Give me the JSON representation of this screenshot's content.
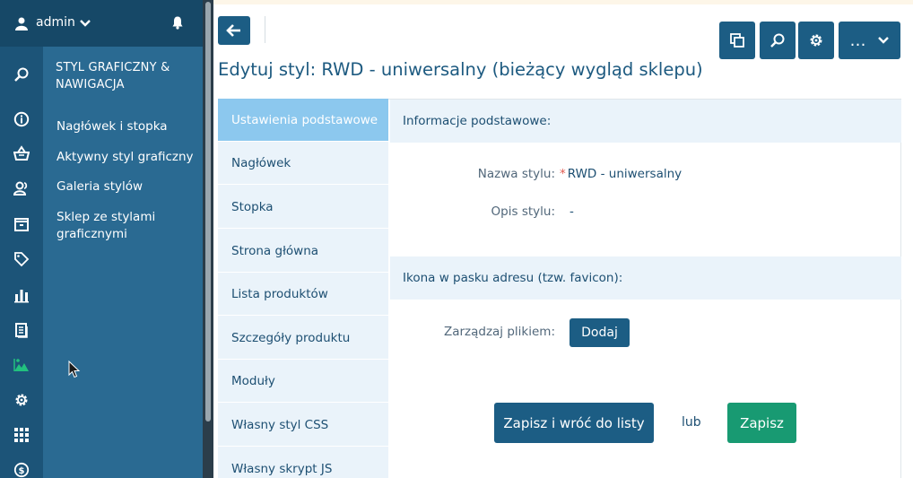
{
  "user": {
    "name": "admin"
  },
  "subnav": {
    "title": "STYL GRAFICZNY & NAWIGACJA",
    "items": [
      {
        "label": "Nagłówek i stopka"
      },
      {
        "label": "Aktywny styl graficzny"
      },
      {
        "label": "Galeria stylów"
      },
      {
        "label": "Sklep ze stylami graficznymi"
      }
    ]
  },
  "rail": {
    "icons": [
      "search-icon",
      "info-icon",
      "basket-icon",
      "users-icon",
      "box-icon",
      "tag-icon",
      "chart-icon",
      "documents-icon",
      "landscape-icon",
      "gear-icon",
      "apps-grid-icon",
      "dollar-icon"
    ],
    "active": "landscape-icon",
    "active_color": "#22c17f"
  },
  "toolbar": {
    "more_label": "…"
  },
  "page": {
    "title": "Edytuj styl: RWD - uniwersalny (bieżący wygląd sklepu)"
  },
  "tabs": [
    {
      "label": "Ustawienia podstawowe",
      "active": true
    },
    {
      "label": "Nagłówek"
    },
    {
      "label": "Stopka"
    },
    {
      "label": "Strona główna"
    },
    {
      "label": "Lista produktów"
    },
    {
      "label": "Szczegóły produktu"
    },
    {
      "label": "Moduły"
    },
    {
      "label": "Własny styl CSS"
    },
    {
      "label": "Własny skrypt JS"
    }
  ],
  "sections": {
    "basic": {
      "heading": "Informacje podstawowe:",
      "name_label": "Nazwa stylu:",
      "name_required": "*",
      "name_value": "RWD - uniwersalny",
      "desc_label": "Opis stylu:",
      "desc_value": "-"
    },
    "favicon": {
      "heading": "Ikona w pasku adresu (tzw. favicon):",
      "file_label": "Zarządzaj plikiem:",
      "add_label": "Dodaj"
    }
  },
  "actions": {
    "save_back_label": "Zapisz i wróć do listy",
    "or_label": "lub",
    "save_label": "Zapisz"
  },
  "colors": {
    "primary": "#1c5d84",
    "save_green": "#189a72",
    "active_tab": "#8cc8ee",
    "sidebar": "#2a6a92"
  }
}
